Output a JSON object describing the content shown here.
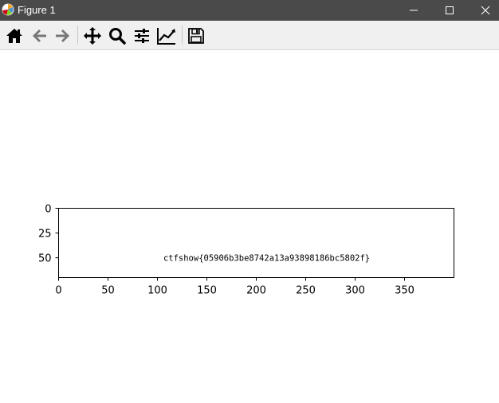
{
  "window": {
    "title": "Figure 1"
  },
  "colors": {
    "titlebar": "#4a4a4a",
    "toolbar": "#f0f0f0",
    "canvas": "#ffffff"
  },
  "toolbar": {
    "items": [
      {
        "name": "home-icon",
        "label": "Home"
      },
      {
        "name": "back-arrow-icon",
        "label": "Back"
      },
      {
        "name": "forward-arrow-icon",
        "label": "Forward"
      },
      {
        "name": "pan-move-icon",
        "label": "Pan"
      },
      {
        "name": "zoom-magnifier-icon",
        "label": "Zoom"
      },
      {
        "name": "configure-subplots-icon",
        "label": "Subplots"
      },
      {
        "name": "edit-axis-icon",
        "label": "Customize"
      },
      {
        "name": "save-floppy-icon",
        "label": "Save"
      }
    ]
  },
  "chart_data": {
    "type": "image",
    "xticks": [
      0,
      50,
      100,
      150,
      200,
      250,
      300,
      350
    ],
    "yticks": [
      0,
      25,
      50
    ],
    "xlim": [
      0,
      400
    ],
    "ylim": [
      70,
      0
    ],
    "xlabel": "",
    "ylabel": "",
    "title": "",
    "image_text": "ctfshow{05906b3be8742a13a93898186bc5802f}",
    "image_text_x": 106,
    "image_text_y": 50
  }
}
